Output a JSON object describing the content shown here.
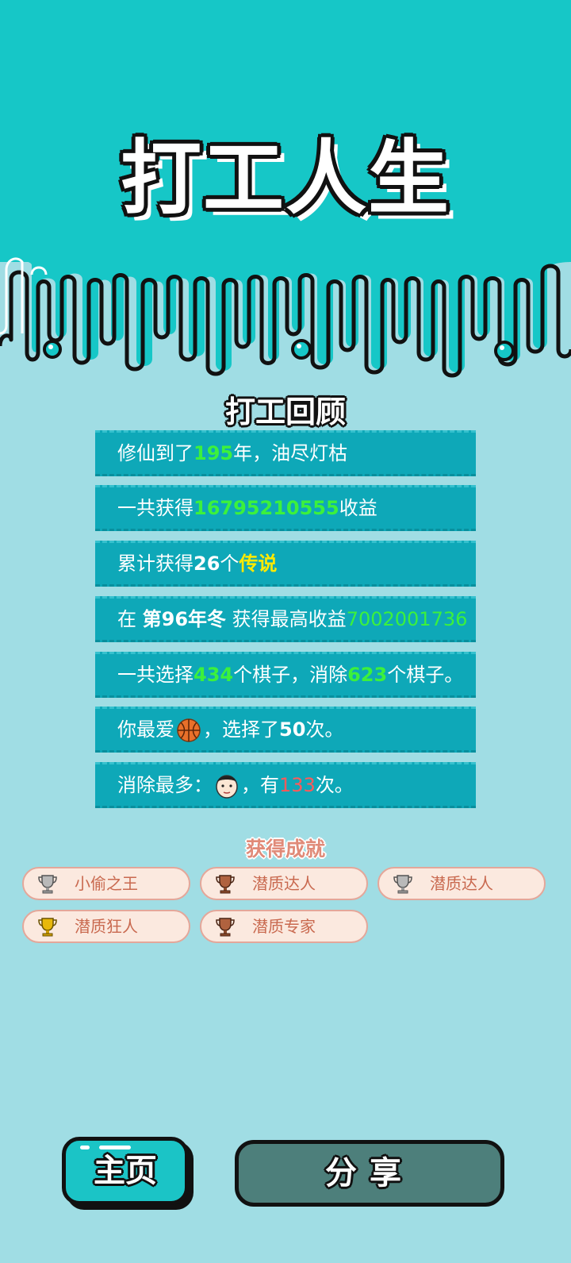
{
  "title": "打工人生",
  "review": {
    "heading": "打工回顾",
    "rows": [
      {
        "pre": "修仙到了",
        "v1": "195",
        "mid": "年，油尽灯枯"
      },
      {
        "pre": "一共获得",
        "v1": "16795210555",
        "mid": "收益"
      },
      {
        "pre": "累计获得",
        "v1": "26",
        "mid": "个",
        "v2": "传说"
      },
      {
        "pre": "在 ",
        "v1": "第96年冬",
        "mid": " 获得最高收益",
        "v2": "7002001736"
      },
      {
        "pre": "一共选择",
        "v1": "434",
        "mid": "个棋子，消除",
        "v2": "623",
        "post": "个棋子。"
      },
      {
        "pre": "你最爱",
        "icon": "basketball-icon",
        "mid": "，选择了",
        "v1": "50",
        "post": "次。"
      },
      {
        "pre": "消除最多：",
        "icon": "face-icon",
        "mid": "，有",
        "v1": "133",
        "post": "次。"
      }
    ]
  },
  "achievements": {
    "heading": "获得成就",
    "items": [
      {
        "label": "小偷之王",
        "trophy": "silver-trophy-icon",
        "color": "#b9b9b9"
      },
      {
        "label": "潜质达人",
        "trophy": "bronze-trophy-icon",
        "color": "#b0623f"
      },
      {
        "label": "潜质达人",
        "trophy": "silver-trophy-icon",
        "color": "#b9b9b9"
      },
      {
        "label": "潜质狂人",
        "trophy": "gold-trophy-icon",
        "color": "#e8b80c"
      },
      {
        "label": "潜质专家",
        "trophy": "bronze-trophy-icon",
        "color": "#b0623f"
      }
    ]
  },
  "buttons": {
    "home": "主页",
    "share": "分享"
  },
  "colors": {
    "teal_top": "#16c7c7",
    "page_bg": "#a0dde4",
    "row_bg": "#0ea8b8",
    "highlight_green": "#3cf13c",
    "highlight_yellow": "#ffea00",
    "highlight_red": "#ff5a5a"
  }
}
